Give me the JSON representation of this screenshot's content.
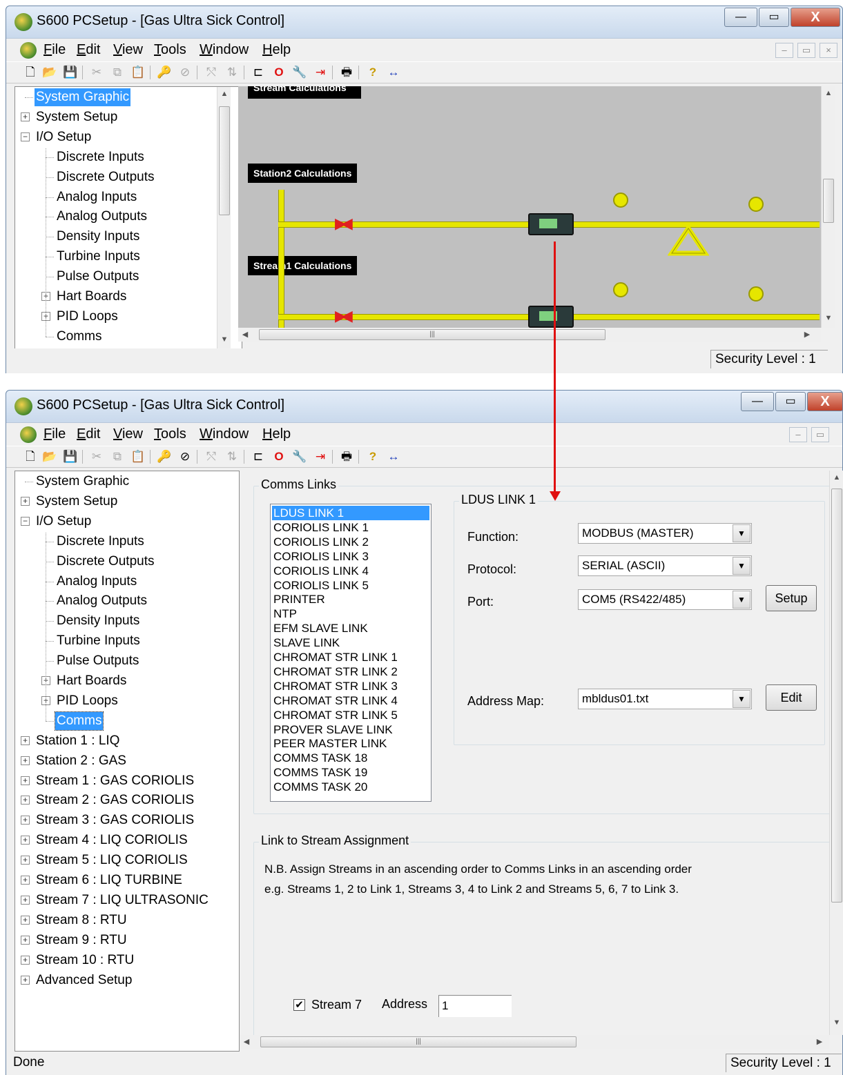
{
  "app": {
    "title": "S600 PCSetup  - [Gas Ultra Sick Control]",
    "menu": [
      "File",
      "Edit",
      "View",
      "Tools",
      "Window",
      "Help"
    ],
    "minimize": "—",
    "restore": "▭",
    "close": "X"
  },
  "top_window": {
    "tree": [
      {
        "label": "System Graphic",
        "level": 0,
        "expander": "",
        "selected": true
      },
      {
        "label": "System Setup",
        "level": 0,
        "expander": "+"
      },
      {
        "label": "I/O Setup",
        "level": 0,
        "expander": "−"
      },
      {
        "label": "Discrete Inputs",
        "level": 1,
        "expander": ""
      },
      {
        "label": "Discrete Outputs",
        "level": 1,
        "expander": ""
      },
      {
        "label": "Analog Inputs",
        "level": 1,
        "expander": ""
      },
      {
        "label": "Analog Outputs",
        "level": 1,
        "expander": ""
      },
      {
        "label": "Density Inputs",
        "level": 1,
        "expander": ""
      },
      {
        "label": "Turbine Inputs",
        "level": 1,
        "expander": ""
      },
      {
        "label": "Pulse Outputs",
        "level": 1,
        "expander": ""
      },
      {
        "label": "Hart Boards",
        "level": 1,
        "expander": "+"
      },
      {
        "label": "PID Loops",
        "level": 1,
        "expander": "+"
      },
      {
        "label": "Comms",
        "level": 1,
        "expander": ""
      }
    ],
    "graphic": {
      "boxes": [
        "Stream Calculations",
        "Station2 Calculations",
        "Stream1 Calculations"
      ]
    },
    "status": "Security Level : 1"
  },
  "bottom_window": {
    "tree": [
      {
        "label": "System Graphic",
        "level": 0,
        "expander": ""
      },
      {
        "label": "System Setup",
        "level": 0,
        "expander": "+"
      },
      {
        "label": "I/O Setup",
        "level": 0,
        "expander": "−"
      },
      {
        "label": "Discrete Inputs",
        "level": 1,
        "expander": ""
      },
      {
        "label": "Discrete Outputs",
        "level": 1,
        "expander": ""
      },
      {
        "label": "Analog Inputs",
        "level": 1,
        "expander": ""
      },
      {
        "label": "Analog Outputs",
        "level": 1,
        "expander": ""
      },
      {
        "label": "Density Inputs",
        "level": 1,
        "expander": ""
      },
      {
        "label": "Turbine Inputs",
        "level": 1,
        "expander": ""
      },
      {
        "label": "Pulse Outputs",
        "level": 1,
        "expander": ""
      },
      {
        "label": "Hart Boards",
        "level": 1,
        "expander": "+"
      },
      {
        "label": "PID Loops",
        "level": 1,
        "expander": "+"
      },
      {
        "label": "Comms",
        "level": 1,
        "expander": "",
        "selected": true
      },
      {
        "label": "Station 1 : LIQ",
        "level": 0,
        "expander": "+"
      },
      {
        "label": "Station 2 : GAS",
        "level": 0,
        "expander": "+"
      },
      {
        "label": "Stream 1 : GAS CORIOLIS",
        "level": 0,
        "expander": "+"
      },
      {
        "label": "Stream 2 : GAS CORIOLIS",
        "level": 0,
        "expander": "+"
      },
      {
        "label": "Stream 3 : GAS CORIOLIS",
        "level": 0,
        "expander": "+"
      },
      {
        "label": "Stream 4 : LIQ CORIOLIS",
        "level": 0,
        "expander": "+"
      },
      {
        "label": "Stream 5 : LIQ CORIOLIS",
        "level": 0,
        "expander": "+"
      },
      {
        "label": "Stream 6 : LIQ TURBINE",
        "level": 0,
        "expander": "+"
      },
      {
        "label": "Stream 7 : LIQ ULTRASONIC",
        "level": 0,
        "expander": "+"
      },
      {
        "label": "Stream 8 : RTU",
        "level": 0,
        "expander": "+"
      },
      {
        "label": "Stream 9 : RTU",
        "level": 0,
        "expander": "+"
      },
      {
        "label": "Stream 10 : RTU",
        "level": 0,
        "expander": "+"
      },
      {
        "label": "Advanced Setup",
        "level": 0,
        "expander": "+"
      }
    ],
    "comms_links": {
      "group_label": "Comms Links",
      "links": [
        "LDUS LINK 1",
        "CORIOLIS LINK 1",
        "CORIOLIS LINK 2",
        "CORIOLIS LINK 3",
        "CORIOLIS LINK 4",
        "CORIOLIS LINK 5",
        "PRINTER",
        "NTP",
        "EFM SLAVE LINK",
        "SLAVE LINK",
        "CHROMAT STR LINK 1",
        "CHROMAT STR LINK 2",
        "CHROMAT STR LINK 3",
        "CHROMAT STR LINK 4",
        "CHROMAT STR LINK 5",
        "PROVER SLAVE LINK",
        "PEER MASTER LINK",
        "COMMS TASK 18",
        "COMMS TASK 19",
        "COMMS TASK 20"
      ],
      "selected_link": "LDUS LINK 1"
    },
    "link_detail": {
      "group_label": "LDUS LINK 1",
      "function_label": "Function:",
      "function_value": "MODBUS (MASTER)",
      "protocol_label": "Protocol:",
      "protocol_value": "SERIAL (ASCII)",
      "port_label": "Port:",
      "port_value": "COM5 (RS422/485)",
      "setup_button": "Setup",
      "address_map_label": "Address Map:",
      "address_map_value": "mbldus01.txt",
      "edit_button": "Edit"
    },
    "assignment": {
      "group_label": "Link to Stream Assignment",
      "note1": "N.B. Assign Streams in an ascending order to Comms Links in an ascending order",
      "note2": "e.g. Streams 1, 2 to Link 1, Streams 3, 4 to Link 2 and Streams 5, 6, 7 to Link 3.",
      "stream_checkbox_label": "Stream 7",
      "stream_checked": true,
      "address_label": "Address",
      "address_value": "1"
    },
    "status_left": "Done",
    "status_right": "Security Level : 1"
  },
  "colors": {
    "selection": "#3399ff",
    "pipe": "#e6e600",
    "valve": "#e02020",
    "connector": "#e01010"
  }
}
